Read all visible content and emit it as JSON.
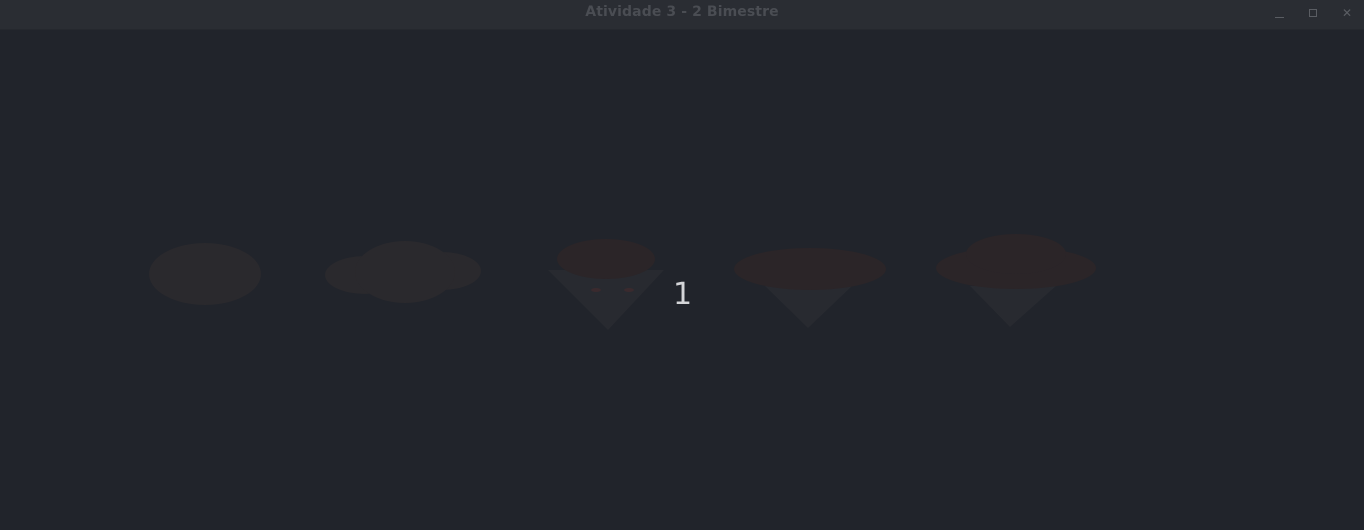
{
  "window": {
    "title": "Atividade 3 - 2 Bimestre",
    "controls": {
      "minimize": "minimize-icon",
      "maximize": "maximize-icon",
      "close": "close-icon",
      "close_glyph": "✕"
    }
  },
  "scene": {
    "counter": "1",
    "colors": {
      "background": "#21242b",
      "cloud": "#2a292d",
      "cloud_dark": "#2b2528",
      "cone": "#282a30",
      "accent": "#3a2a2e"
    }
  }
}
